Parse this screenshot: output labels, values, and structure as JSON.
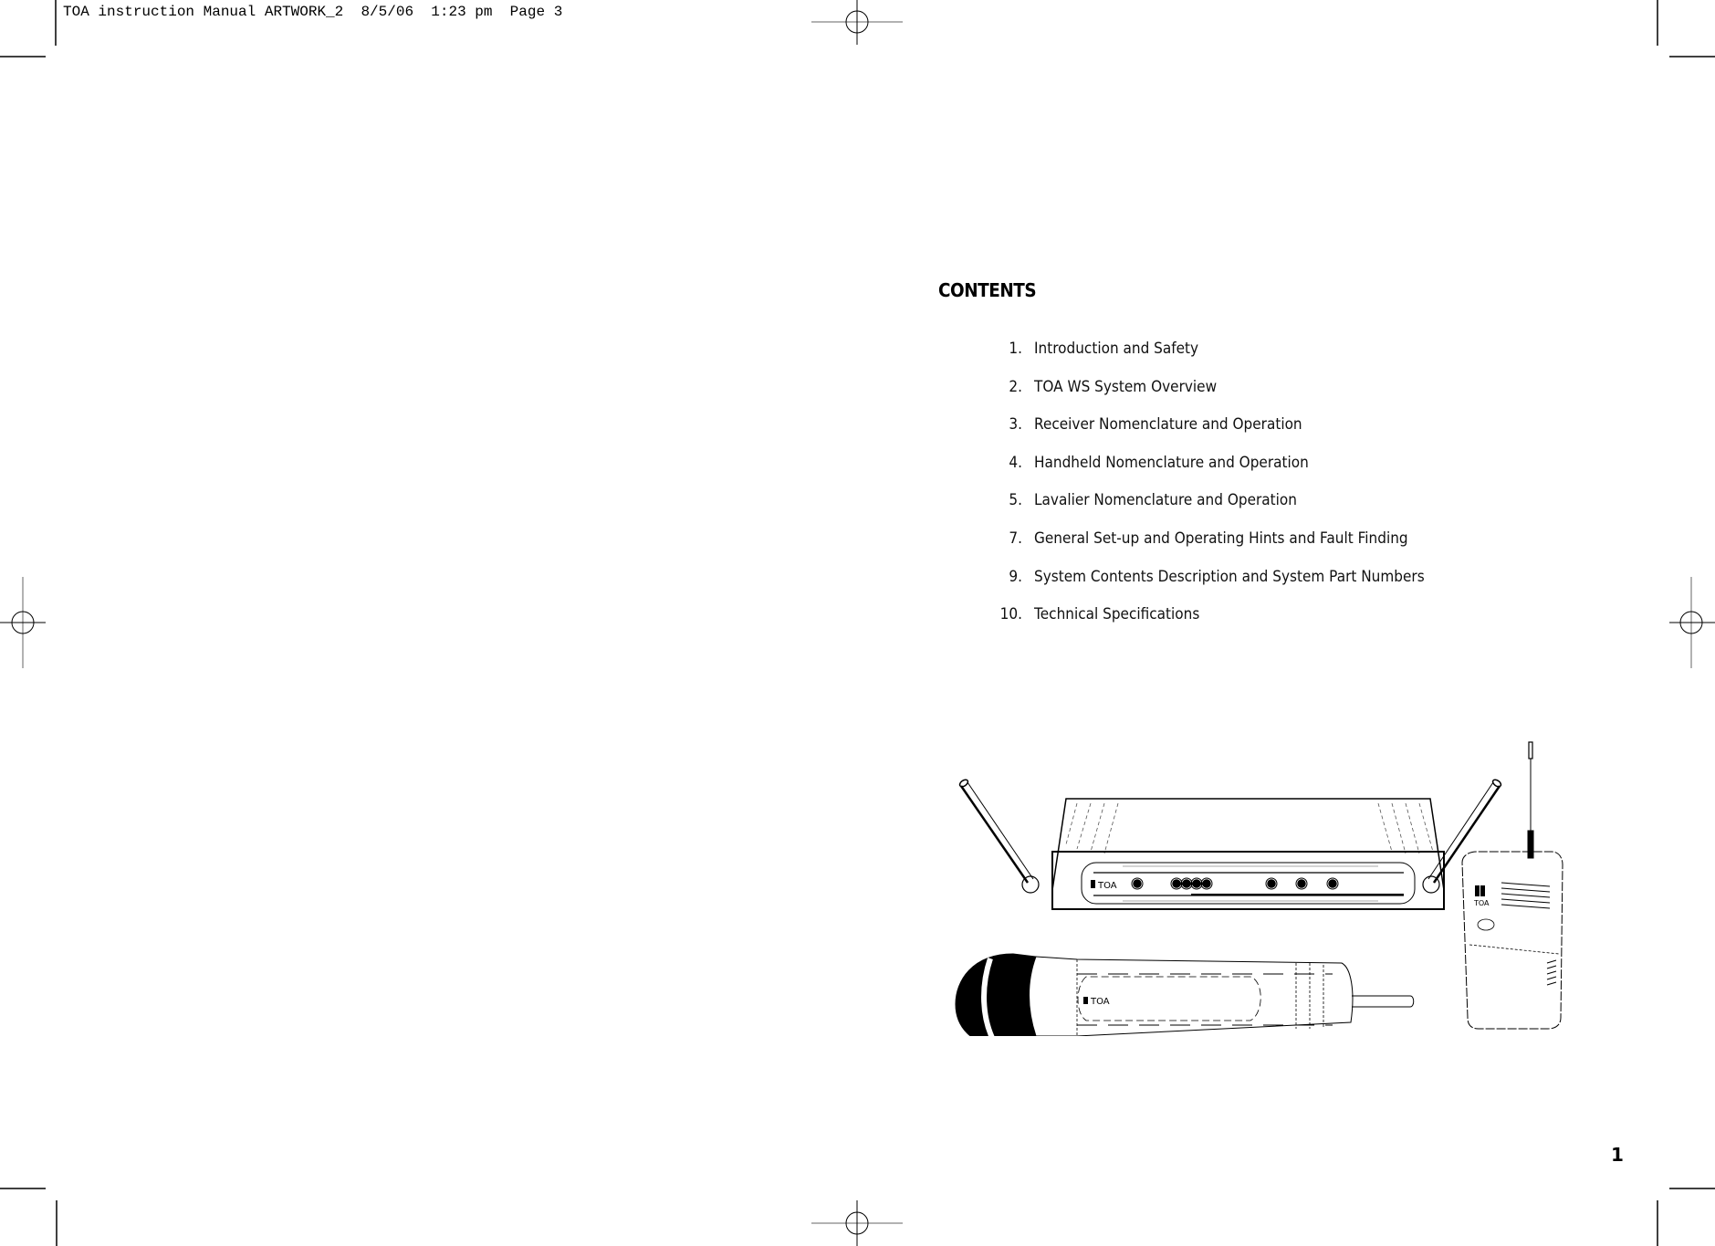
{
  "slug_line": "TOA instruction Manual ARTWORK_2  8/5/06  1:23 pm  Page 3",
  "contents": {
    "title": "CONTENTS",
    "items": [
      {
        "page": "1.",
        "label": "Introduction and Safety"
      },
      {
        "page": "2.",
        "label": "TOA WS System Overview"
      },
      {
        "page": "3.",
        "label": "Receiver Nomenclature and Operation"
      },
      {
        "page": "4.",
        "label": "Handheld Nomenclature and Operation"
      },
      {
        "page": "5.",
        "label": "Lavalier Nomenclature and Operation"
      },
      {
        "page": "7.",
        "label": "General Set-up and Operating Hints and Fault Finding"
      },
      {
        "page": "9.",
        "label": "System Contents Description and System Part Numbers"
      },
      {
        "page": "10.",
        "label": "Technical Specifications"
      }
    ]
  },
  "illustration": {
    "receiver_brand": "TOA",
    "handheld_brand": "TOA",
    "bodypack_brand": "TOA"
  },
  "page_number": "1"
}
